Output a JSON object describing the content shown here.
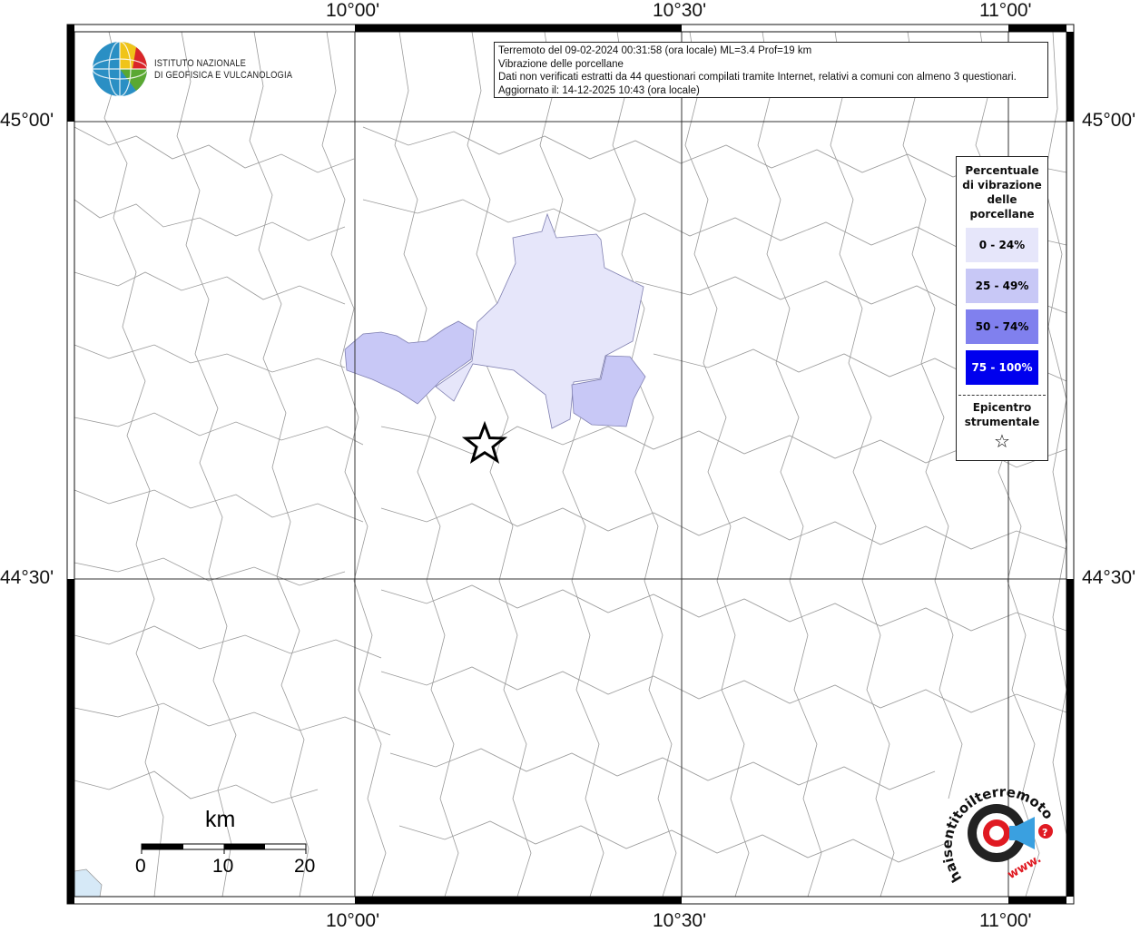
{
  "info": {
    "line1": "Terremoto del 09-02-2024 00:31:58 (ora locale) ML=3.4 Prof=19 km",
    "line2": "Vibrazione delle porcellane",
    "line3": "Dati non verificati estratti da 44 questionari compilati tramite Internet, relativi a comuni con almeno 3 questionari.",
    "line4": "Aggiornato il: 14-12-2025 10:43 (ora locale)"
  },
  "logo_ingv": {
    "line1": "ISTITUTO NAZIONALE",
    "line2": "DI GEOFISICA E VULCANOLOGIA"
  },
  "axes": {
    "top": [
      "10°00'",
      "10°30'",
      "11°00'"
    ],
    "bottom": [
      "10°00'",
      "10°30'",
      "11°00'"
    ],
    "left": [
      "45°00'",
      "44°30'"
    ],
    "right": [
      "45°00'",
      "44°30'"
    ]
  },
  "legend": {
    "title": "Percentuale di vibrazione delle porcellane",
    "items": [
      {
        "label": "0 - 24%",
        "color": "#e6e6fa",
        "text_color": "#000000"
      },
      {
        "label": "25 - 49%",
        "color": "#c8c8f6",
        "text_color": "#000000"
      },
      {
        "label": "50 - 74%",
        "color": "#8080ee",
        "text_color": "#000000"
      },
      {
        "label": "75 - 100%",
        "color": "#0000ee",
        "text_color": "#ffffff"
      }
    ],
    "epicenter_label": "Epicentro strumentale",
    "epicenter_symbol": "☆"
  },
  "scale": {
    "unit": "km",
    "labels": [
      "0",
      "10",
      "20"
    ]
  },
  "hsn_logo": {
    "text": "haisentitoilterremoto.it",
    "url_text": "www.",
    "icon": "megaphone-target-icon"
  },
  "colors": {
    "class_low": "#e6e6fa",
    "class_mid": "#c8c8f6",
    "border_line": "#999999"
  }
}
